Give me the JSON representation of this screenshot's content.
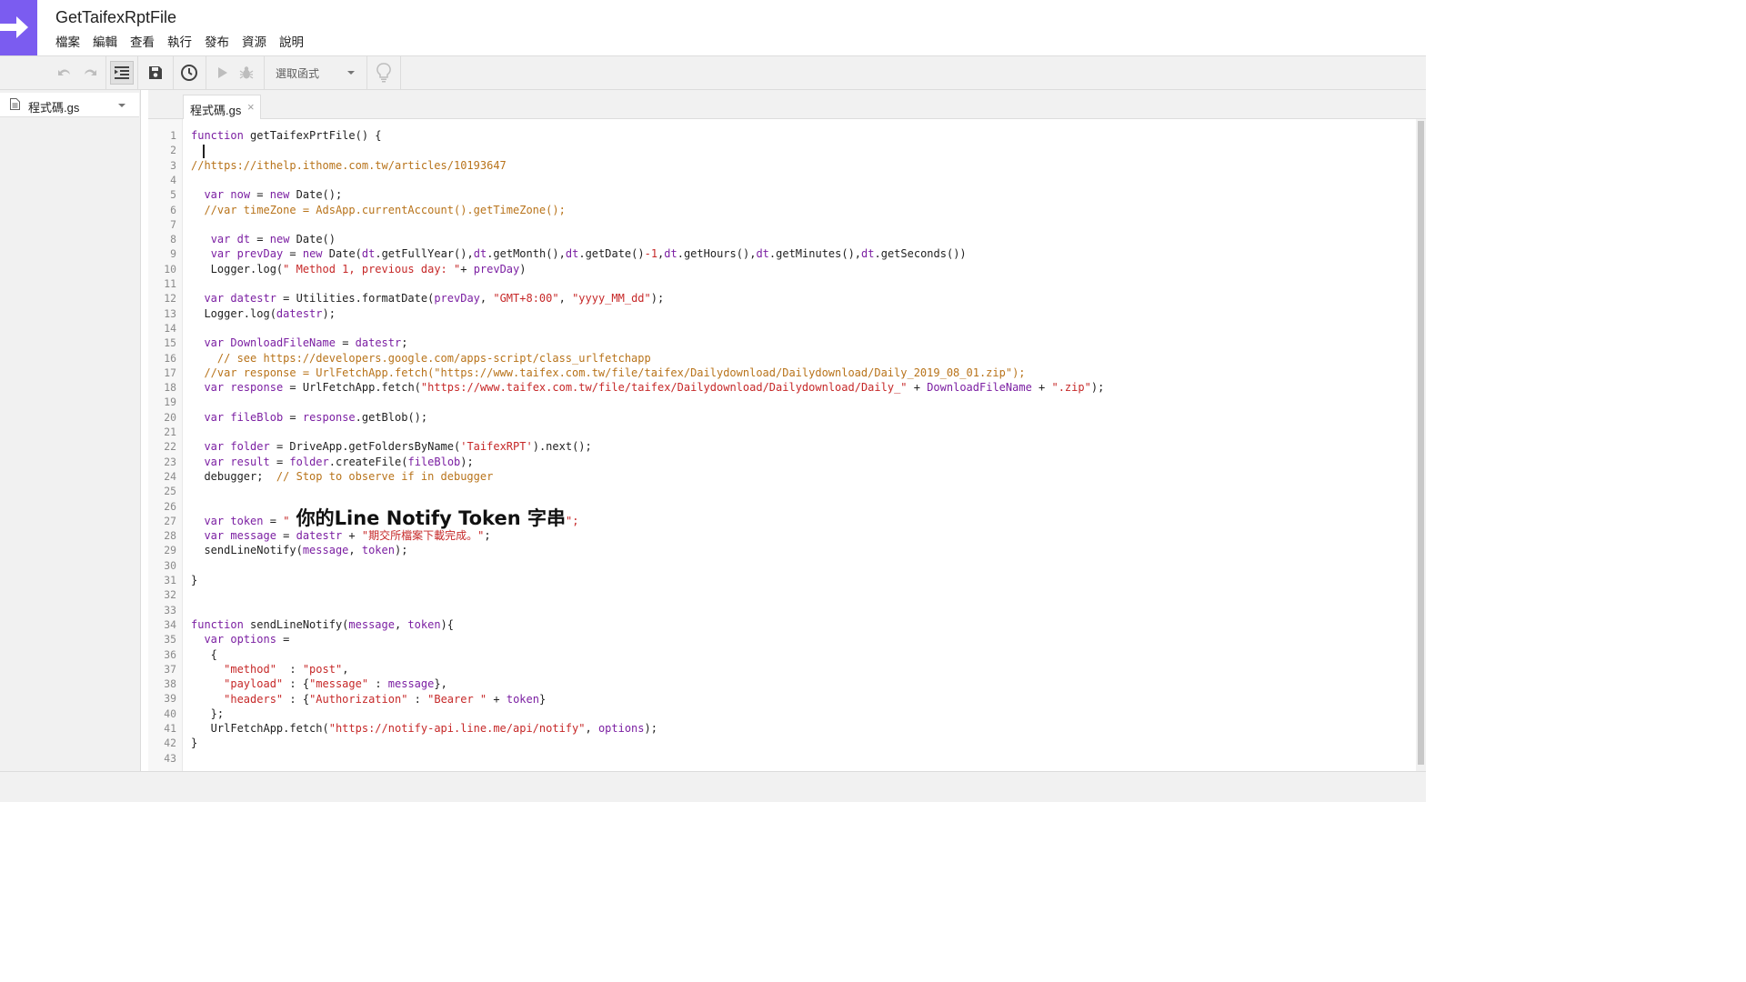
{
  "app": {
    "title": "GetTaifexRptFile",
    "logo_icon": "arrow-right-icon",
    "accent_color": "#7b5cf0"
  },
  "menu": [
    "檔案",
    "編輯",
    "查看",
    "執行",
    "發布",
    "資源",
    "說明"
  ],
  "toolbar": {
    "icons": [
      "undo-icon",
      "redo-icon",
      "indent-icon",
      "save-icon",
      "triggers-clock-icon",
      "run-icon",
      "debug-bug-icon",
      "lightbulb-icon"
    ],
    "function_select": "選取函式"
  },
  "files": [
    {
      "name": "程式碼.gs"
    }
  ],
  "editor": {
    "tab_label": "程式碼.gs",
    "tab_close": "×",
    "line_numbers": [
      "1",
      "2",
      "3",
      "4",
      "5",
      "6",
      "7",
      "8",
      "9",
      "10",
      "11",
      "12",
      "13",
      "14",
      "15",
      "16",
      "17",
      "18",
      "19",
      "20",
      "21",
      "22",
      "23",
      "24",
      "25",
      "26",
      "27",
      "28",
      "29",
      "30",
      "31",
      "32",
      "33",
      "34",
      "35",
      "36",
      "37",
      "38",
      "39",
      "40",
      "41",
      "42",
      "43"
    ],
    "code": {
      "l1": {
        "kw": "function",
        "rest": " getTaifexPrtFile() {"
      },
      "l3": {
        "cm": "//https://ithelp.ithome.com.tw/articles/10193647"
      },
      "l5": {
        "pre": "  ",
        "kw": "var",
        "vr": " now",
        "rest": " = ",
        "kw2": "new",
        "rest2": " Date();"
      },
      "l6": {
        "cm": "  //var timeZone = AdsApp.currentAccount().getTimeZone();"
      },
      "l8": {
        "pre": "   ",
        "kw": "var",
        "vr": " dt",
        "rest": " = ",
        "kw2": "new",
        "rest2": " Date()"
      },
      "l9": {
        "pre": "   ",
        "kw": "var",
        "vr": " prevDay",
        "rest": " = ",
        "kw2": "new",
        "rest2": " Date(",
        "v1": "dt",
        "r1": ".getFullYear(),",
        "v2": "dt",
        "r2": ".getMonth(),",
        "v3": "dt",
        "r3": ".getDate()",
        "n1": "-1",
        "r4": ",",
        "v4": "dt",
        "r5": ".getHours(),",
        "v5": "dt",
        "r6": ".getMinutes(),",
        "v6": "dt",
        "r7": ".getSeconds())"
      },
      "l10": {
        "pre": "   Logger.log(",
        "st": "\" Method 1, previous day: \"",
        "rest": "+ ",
        "vr": "prevDay",
        "rest2": ")"
      },
      "l12": {
        "pre": "  ",
        "kw": "var",
        "vr": " datestr",
        "rest": " = Utilities.formatDate(",
        "v1": "prevDay",
        "r1": ", ",
        "s1": "\"GMT+8:00\"",
        "r2": ", ",
        "s2": "\"yyyy_MM_dd\"",
        "r3": ");"
      },
      "l13": {
        "pre": "  Logger.log(",
        "vr": "datestr",
        "rest": ");"
      },
      "l15": {
        "pre": "  ",
        "kw": "var",
        "vr": " DownloadFileName",
        "rest": " = ",
        "vr2": "datestr",
        "rest2": ";"
      },
      "l16": {
        "cm": "    // see https://developers.google.com/apps-script/class_urlfetchapp"
      },
      "l17": {
        "cm": "  //var response = UrlFetchApp.fetch(\"https://www.taifex.com.tw/file/taifex/Dailydownload/Dailydownload/Daily_2019_08_01.zip\");"
      },
      "l18": {
        "pre": "  ",
        "kw": "var",
        "vr": " response",
        "rest": " = UrlFetchApp.fetch(",
        "s1": "\"https://www.taifex.com.tw/file/taifex/Dailydownload/Dailydownload/Daily_\"",
        "r1": " + ",
        "v1": "DownloadFileName",
        "r2": " + ",
        "s2": "\".zip\"",
        "r3": ");"
      },
      "l20": {
        "pre": "  ",
        "kw": "var",
        "vr": " fileBlob",
        "rest": " = ",
        "vr2": "response",
        "rest2": ".getBlob();"
      },
      "l22": {
        "pre": "  ",
        "kw": "var",
        "vr": " folder",
        "rest": " = DriveApp.getFoldersByName(",
        "st": "'TaifexRPT'",
        "rest2": ").next();"
      },
      "l23": {
        "pre": "  ",
        "kw": "var",
        "vr": " result",
        "rest": " = ",
        "vr2": "folder",
        "rest2": ".createFile(",
        "vr3": "fileBlob",
        "rest3": ");"
      },
      "l24": {
        "pre": "  debugger;  ",
        "cm": "// Stop to observe if in debugger"
      },
      "l27": {
        "pre": "  ",
        "kw": "var",
        "vr": " token",
        "rest": " = ",
        "q1": "\" ",
        "big": "你的Line Notify Token 字串",
        "q2": "\";"
      },
      "l28": {
        "pre": "  ",
        "kw": "var",
        "vr": " message",
        "rest": " = ",
        "vr2": "datestr",
        "rest2": " + ",
        "st": "\"期交所檔案下載完成。\"",
        "rest3": ";"
      },
      "l29": {
        "pre": "  sendLineNotify(",
        "v1": "message",
        "r1": ", ",
        "v2": "token",
        "r2": ");"
      },
      "l31": {
        "rest": "}"
      },
      "l34": {
        "kw": "function",
        "rest": " sendLineNotify(",
        "v1": "message",
        "r1": ", ",
        "v2": "token",
        "r2": "){"
      },
      "l35": {
        "pre": "  ",
        "kw": "var",
        "vr": " options",
        "rest": " ="
      },
      "l36": {
        "rest": "   {"
      },
      "l37": {
        "pre": "     ",
        "s1": "\"method\"",
        "r1": "  : ",
        "s2": "\"post\"",
        "r2": ","
      },
      "l38": {
        "pre": "     ",
        "s1": "\"payload\"",
        "r1": " : {",
        "s2": "\"message\"",
        "r2": " : ",
        "v1": "message",
        "r3": "},"
      },
      "l39": {
        "pre": "     ",
        "s1": "\"headers\"",
        "r1": " : {",
        "s2": "\"Authorization\"",
        "r2": " : ",
        "s3": "\"Bearer \"",
        "r3": " + ",
        "v1": "token",
        "r4": "}"
      },
      "l40": {
        "rest": "   };"
      },
      "l41": {
        "pre": "   UrlFetchApp.fetch(",
        "st": "\"https://notify-api.line.me/api/notify\"",
        "r1": ", ",
        "v1": "options",
        "r2": ");"
      },
      "l42": {
        "rest": "}"
      }
    }
  }
}
